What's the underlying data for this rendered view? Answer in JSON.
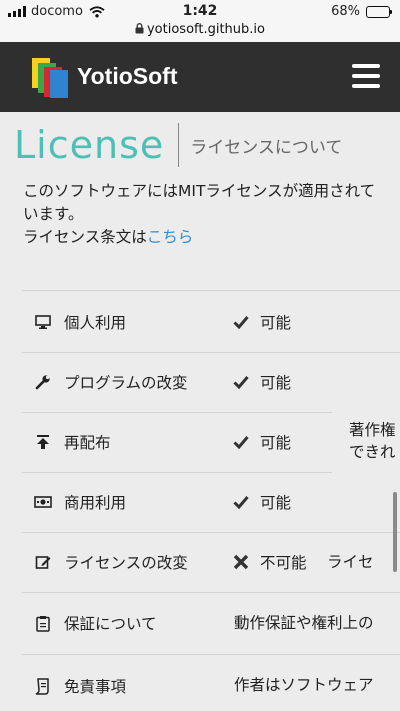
{
  "status_bar": {
    "carrier": "docomo",
    "time": "1:42",
    "url": "yotiosoft.github.io",
    "battery": "68%",
    "battery_level": 0.68
  },
  "header": {
    "brand": "YotioSoft",
    "logo_colors": [
      "#f4d21f",
      "#3aa84a",
      "#d7282f",
      "#2f83d1"
    ]
  },
  "page": {
    "title_en": "License",
    "title_ja": "ライセンスについて",
    "desc_line": "このソフトウェアにはMITライセンスが適用されています。",
    "license_text_prefix": "ライセンス条文は",
    "license_link": "こちら"
  },
  "table": {
    "rows": [
      {
        "icon": "monitor-icon",
        "label": "個人利用",
        "mark": "check",
        "perm": "可能",
        "note": ""
      },
      {
        "icon": "wrench-icon",
        "label": "プログラムの改変",
        "mark": "check",
        "perm": "可能",
        "note": ""
      },
      {
        "icon": "upload-icon",
        "label": "再配布",
        "mark": "check",
        "perm": "可能",
        "note": ""
      },
      {
        "icon": "money-icon",
        "label": "商用利用",
        "mark": "check",
        "perm": "可能",
        "note": ""
      },
      {
        "icon": "edit-icon",
        "label": "ライセンスの改変",
        "mark": "cross",
        "perm": "不可能",
        "note": "ライセ"
      },
      {
        "icon": "clipboard-icon",
        "label": "保証について",
        "mark": "",
        "perm": "",
        "note": "動作保証や権利上の"
      },
      {
        "icon": "document-icon",
        "label": "免責事項",
        "mark": "",
        "perm": "",
        "note": "作者はソフトウェア"
      }
    ],
    "merged_note_line1": "著作権",
    "merged_note_line2": "できれ"
  }
}
